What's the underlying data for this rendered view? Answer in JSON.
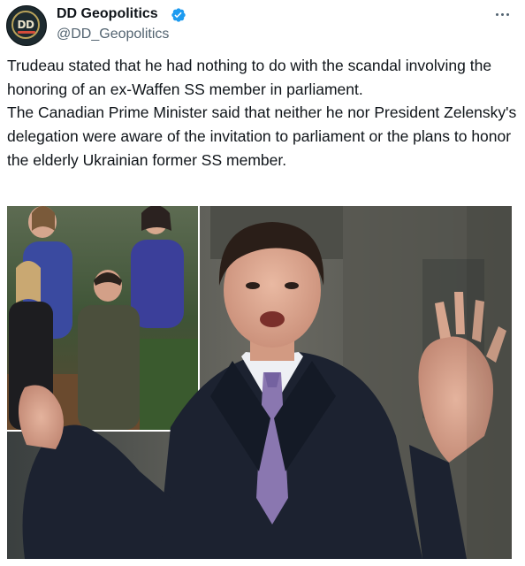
{
  "author": {
    "display_name": "DD Geopolitics",
    "handle": "@DD_Geopolitics",
    "verified": true,
    "avatar_icon": "dd-geopolitics-logo-icon",
    "avatar_logo_text": "DD"
  },
  "tweet": {
    "paragraphs": [
      "Trudeau stated that he had nothing to do with the scandal involving the honoring of an ex-Waffen SS member in parliament.",
      "The Canadian Prime Minister said that neither he nor President Zelensky's delegation were aware of the invitation to parliament or the plans to honor the elderly Ukrainian former SS member."
    ]
  },
  "menu_icon": "more-horizontal-icon",
  "colors": {
    "text": "#0f1419",
    "secondary": "#536471",
    "verified_blue": "#1d9bf0"
  }
}
